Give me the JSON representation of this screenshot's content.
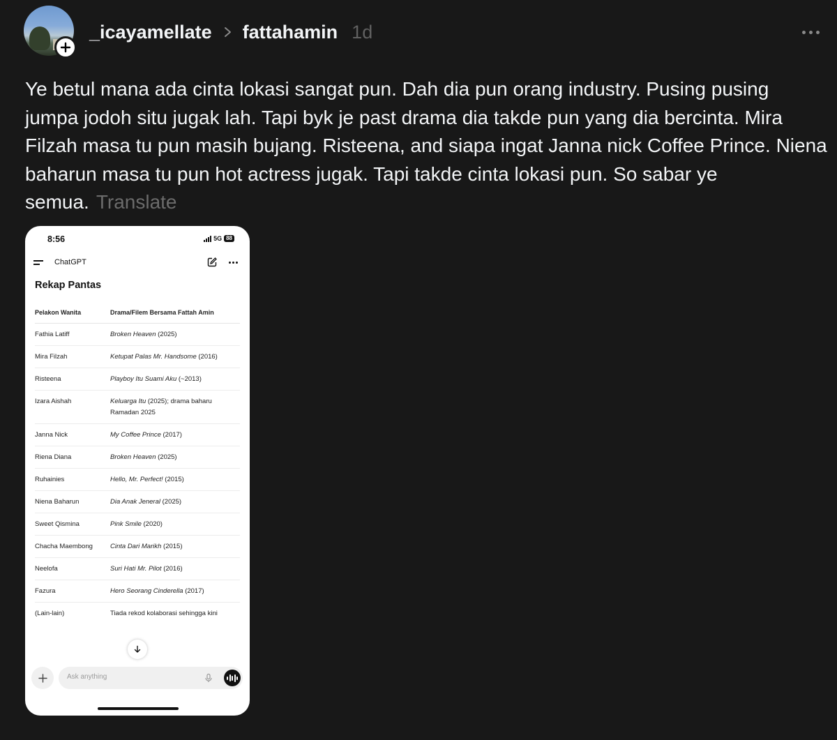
{
  "post": {
    "author": "_icayamellate",
    "reply_to": "fattahamin",
    "time": "1d",
    "text": "Ye betul mana ada cinta lokasi sangat pun. Dah dia pun orang industry. Pusing pusing jumpa jodoh situ jugak lah. Tapi byk je past drama dia takde pun yang dia bercinta. Mira Filzah masa tu pun masih bujang. Risteena, and siapa ingat Janna nick Coffee Prince. Niena baharun masa tu pun hot actress jugak. Tapi takde cinta lokasi pun. So sabar ye semua.",
    "translate_label": "Translate"
  },
  "screenshot": {
    "status_time": "8:56",
    "network": "5G",
    "battery": "88",
    "app_title": "ChatGPT",
    "table_title": "Rekap Pantas",
    "headers": [
      "Pelakon Wanita",
      "Drama/Filem Bersama Fattah Amin"
    ],
    "rows": [
      {
        "actress": "Fathia Latiff",
        "title": "Broken Heaven",
        "extra": " (2025)"
      },
      {
        "actress": "Mira Filzah",
        "title": "Ketupat Palas Mr. Handsome",
        "extra": " (2016)"
      },
      {
        "actress": "Risteena",
        "title": "Playboy Itu Suami Aku",
        "extra": " (~2013)"
      },
      {
        "actress": "Izara Aishah",
        "title": "Keluarga Itu",
        "extra": " (2025); drama baharu Ramadan 2025"
      },
      {
        "actress": "Janna Nick",
        "title": "My Coffee Prince",
        "extra": " (2017)"
      },
      {
        "actress": "Riena Diana",
        "title": "Broken Heaven",
        "extra": " (2025)"
      },
      {
        "actress": "Ruhainies",
        "title": "Hello, Mr. Perfect!",
        "extra": " (2015)"
      },
      {
        "actress": "Niena Baharun",
        "title": "Dia Anak Jeneral",
        "extra": " (2025)"
      },
      {
        "actress": "Sweet Qismina",
        "title": "Pink Smile",
        "extra": " (2020)"
      },
      {
        "actress": "Chacha Maembong",
        "title": "Cinta Dari Marikh",
        "extra": " (2015)"
      },
      {
        "actress": "Neelofa",
        "title": "Suri Hati Mr. Pilot",
        "extra": " (2016)"
      },
      {
        "actress": "Fazura",
        "title": "Hero Seorang Cinderella",
        "extra": " (2017)"
      },
      {
        "actress": "(Lain-lain)",
        "title": "",
        "extra": "Tiada rekod kolaborasi sehingga kini"
      }
    ],
    "composer_placeholder": "Ask anything"
  },
  "icons": {
    "follow": "plus-icon",
    "breadcrumb": "chevron-right-icon",
    "more": "more-horizontal-icon",
    "menu": "menu-icon",
    "edit": "new-chat-icon",
    "scroll": "arrow-down-icon",
    "mic": "mic-icon",
    "voice": "voice-mode-icon"
  },
  "colors": {
    "background": "#181818",
    "text": "#f3f5f7",
    "muted": "#6b6b6b"
  }
}
